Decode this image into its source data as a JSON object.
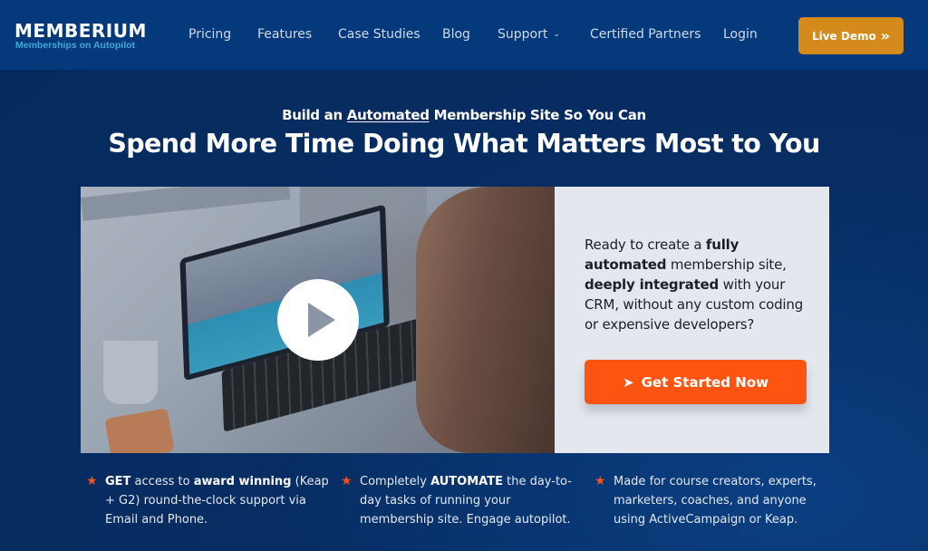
{
  "header": {
    "logo_title": "MEMBERIUM",
    "logo_subtitle": "Memberships on Autopilot",
    "nav": [
      {
        "label": "Pricing"
      },
      {
        "label": "Features"
      },
      {
        "label": "Case Studies"
      },
      {
        "label": "Blog"
      },
      {
        "label": "Support",
        "has_dropdown": true
      },
      {
        "label": "Certified Partners"
      },
      {
        "label": "Login"
      }
    ],
    "cta_label": "Live Demo",
    "cta_icon": "double-chevron-right-icon",
    "cta_icon_glyph": "»"
  },
  "hero": {
    "subheadline_pre": "Build an ",
    "subheadline_underlined": "Automated",
    "subheadline_post": " Membership Site So You Can",
    "headline": "Spend More Time Doing What Matters Most to You"
  },
  "video": {
    "play_icon": "play-icon"
  },
  "cta_card": {
    "text_parts": [
      {
        "text": "Ready to create a ",
        "bold": false
      },
      {
        "text": "fully automated",
        "bold": true
      },
      {
        "text": " membership site, ",
        "bold": false
      },
      {
        "text": "deeply integrated",
        "bold": true
      },
      {
        "text": " with your CRM, without any custom coding or expensive developers?",
        "bold": false
      }
    ],
    "button_label": "Get Started Now",
    "button_icon": "send-arrow-icon",
    "button_icon_glyph": "➤"
  },
  "features": [
    {
      "icon_glyph": "★",
      "parts": [
        {
          "text": "GET",
          "bold": true
        },
        {
          "text": " access to ",
          "bold": false
        },
        {
          "text": "award winning",
          "bold": true
        },
        {
          "text": " (Keap + G2) round-the-clock support via Email and Phone.",
          "bold": false
        }
      ]
    },
    {
      "icon_glyph": "★",
      "parts": [
        {
          "text": "Completely ",
          "bold": false
        },
        {
          "text": "AUTOMATE",
          "bold": true
        },
        {
          "text": " the day-to-day tasks of running your membership site. Engage autopilot.",
          "bold": false
        }
      ]
    },
    {
      "icon_glyph": "★",
      "parts": [
        {
          "text": "Made for course creators, experts, marketers, coaches, and anyone using ActiveCampaign or Keap.",
          "bold": false
        }
      ]
    }
  ],
  "colors": {
    "header_bg": "#043a7c",
    "page_bg": "#062a5c",
    "live_demo": "#d48b1c",
    "get_started": "#fd5412",
    "star": "#f4531e",
    "logo_sub": "#41a6d9"
  }
}
